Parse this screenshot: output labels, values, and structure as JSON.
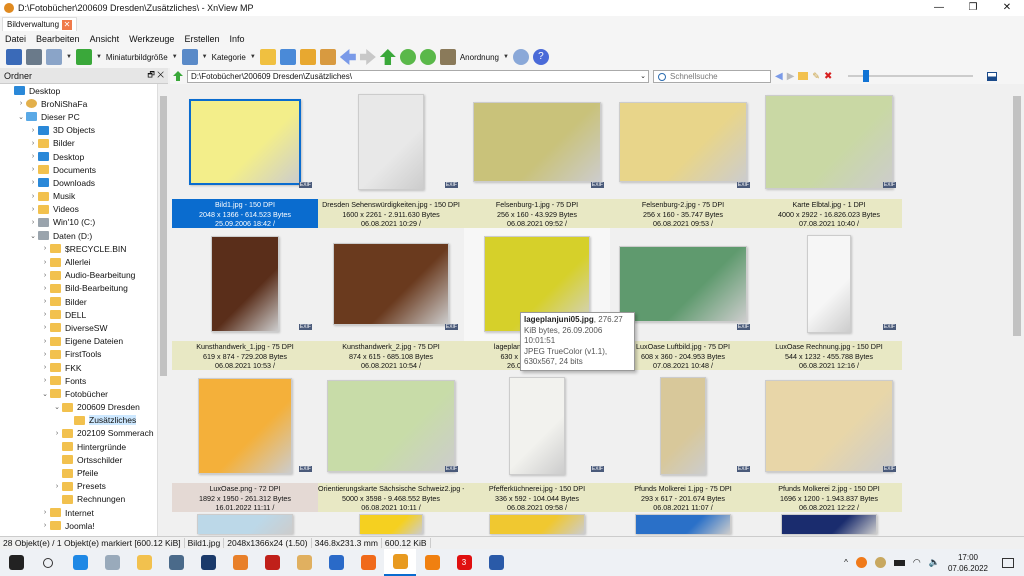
{
  "window": {
    "title": "D:\\Fotobücher\\200609 Dresden\\Zusätzliches\\ - XnView MP",
    "minimize": "—",
    "maximize": "❐",
    "close": "✕"
  },
  "tab": {
    "label": "Bildverwaltung",
    "close": "✕"
  },
  "menu": [
    "Datei",
    "Bearbeiten",
    "Ansicht",
    "Werkzeuge",
    "Erstellen",
    "Info"
  ],
  "toolbar": {
    "thumb_size": "Miniaturbildgröße",
    "category": "Kategorie",
    "arrange": "Anordnung"
  },
  "panel": {
    "title": "Ordner",
    "float": "🗗",
    "close": "✕"
  },
  "address": {
    "path": "D:\\Fotobücher\\200609 Dresden\\Zusätzliches\\",
    "search_placeholder": "Schnellsuche",
    "zoom_percent": 10
  },
  "tree": [
    {
      "label": "Desktop",
      "level": 0,
      "arrow": "",
      "icon": "blue"
    },
    {
      "label": "BroNiShaFa",
      "level": 1,
      "arrow": ">",
      "icon": "user"
    },
    {
      "label": "Dieser PC",
      "level": 1,
      "arrow": "v",
      "icon": "pc"
    },
    {
      "label": "3D Objects",
      "level": 2,
      "arrow": ">",
      "icon": "blue"
    },
    {
      "label": "Bilder",
      "level": 2,
      "arrow": ">",
      "icon": "folder"
    },
    {
      "label": "Desktop",
      "level": 2,
      "arrow": ">",
      "icon": "blue"
    },
    {
      "label": "Documents",
      "level": 2,
      "arrow": ">",
      "icon": "folder"
    },
    {
      "label": "Downloads",
      "level": 2,
      "arrow": ">",
      "icon": "blue"
    },
    {
      "label": "Musik",
      "level": 2,
      "arrow": ">",
      "icon": "folder"
    },
    {
      "label": "Videos",
      "level": 2,
      "arrow": ">",
      "icon": "folder"
    },
    {
      "label": "Win'10 (C:)",
      "level": 2,
      "arrow": ">",
      "icon": "drive"
    },
    {
      "label": "Daten (D:)",
      "level": 2,
      "arrow": "v",
      "icon": "drive"
    },
    {
      "label": "$RECYCLE.BIN",
      "level": 3,
      "arrow": ">",
      "icon": "folder"
    },
    {
      "label": "Allerlei",
      "level": 3,
      "arrow": ">",
      "icon": "folder"
    },
    {
      "label": "Audio-Bearbeitung",
      "level": 3,
      "arrow": ">",
      "icon": "folder"
    },
    {
      "label": "Bild-Bearbeitung",
      "level": 3,
      "arrow": ">",
      "icon": "folder"
    },
    {
      "label": "Bilder",
      "level": 3,
      "arrow": ">",
      "icon": "folder"
    },
    {
      "label": "DELL",
      "level": 3,
      "arrow": ">",
      "icon": "folder"
    },
    {
      "label": "DiverseSW",
      "level": 3,
      "arrow": ">",
      "icon": "folder"
    },
    {
      "label": "Eigene Dateien",
      "level": 3,
      "arrow": ">",
      "icon": "folder"
    },
    {
      "label": "FirstTools",
      "level": 3,
      "arrow": ">",
      "icon": "folder"
    },
    {
      "label": "FKK",
      "level": 3,
      "arrow": ">",
      "icon": "folder"
    },
    {
      "label": "Fonts",
      "level": 3,
      "arrow": ">",
      "icon": "folder"
    },
    {
      "label": "Fotobücher",
      "level": 3,
      "arrow": "v",
      "icon": "folder"
    },
    {
      "label": "200609 Dresden",
      "level": 4,
      "arrow": "v",
      "icon": "folder"
    },
    {
      "label": "Zusätzliches",
      "level": 5,
      "arrow": "",
      "icon": "folder",
      "selected": true
    },
    {
      "label": "202109 Sommerach",
      "level": 4,
      "arrow": ">",
      "icon": "folder"
    },
    {
      "label": "Hintergründe",
      "level": 4,
      "arrow": "",
      "icon": "folder"
    },
    {
      "label": "Ortsschilder",
      "level": 4,
      "arrow": "",
      "icon": "folder"
    },
    {
      "label": "Pfeile",
      "level": 4,
      "arrow": "",
      "icon": "folder"
    },
    {
      "label": "Presets",
      "level": 4,
      "arrow": ">",
      "icon": "folder"
    },
    {
      "label": "Rechnungen",
      "level": 4,
      "arrow": "",
      "icon": "folder"
    },
    {
      "label": "Internet",
      "level": 3,
      "arrow": ">",
      "icon": "folder"
    },
    {
      "label": "Joomla!",
      "level": 3,
      "arrow": ">",
      "icon": "folder"
    }
  ],
  "files": [
    {
      "name": "Bild1.jpg - 150 DPI",
      "dims": "2048 x 1366 - 614.523 Bytes",
      "date": "25.09.2006 18:42 /",
      "color": "#f3ee8a",
      "w": 112,
      "h": 86,
      "selected": true
    },
    {
      "name": "Dresden Sehenswürdigkeiten.jpg - 150 DPI",
      "dims": "1600 x 2261 - 2.911.630 Bytes",
      "date": "06.08.2021 10:29 /",
      "color": "#e8e8e8",
      "w": 66,
      "h": 96
    },
    {
      "name": "Felsenburg-1.jpg - 75 DPI",
      "dims": "256 x 160 - 43.929 Bytes",
      "date": "06.08.2021 09:52 /",
      "color": "#c9c27a",
      "w": 128,
      "h": 80
    },
    {
      "name": "Felsenburg-2.jpg - 75 DPI",
      "dims": "256 x 160 - 35.747 Bytes",
      "date": "06.08.2021 09:53 /",
      "color": "#e8d58a",
      "w": 128,
      "h": 80
    },
    {
      "name": "Karte Elbtal.jpg - 1 DPI",
      "dims": "4000 x 2922 - 16.826.023 Bytes",
      "date": "07.08.2021 10:40 /",
      "color": "#c9d8a4",
      "w": 128,
      "h": 94
    },
    {
      "name": "Kunsthandwerk_1.jpg - 75 DPI",
      "dims": "619 x 874 - 729.208 Bytes",
      "date": "06.08.2021 10:53 /",
      "color": "#5a2e1a",
      "w": 68,
      "h": 96
    },
    {
      "name": "Kunsthandwerk_2.jpg - 75 DPI",
      "dims": "874 x 615 - 685.108 Bytes",
      "date": "06.08.2021 10:54 /",
      "color": "#6a3a1e",
      "w": 116,
      "h": 82
    },
    {
      "name": "lageplanjuni05.jpg - 75 DPI",
      "dims": "630 x 567 - 276.27 KiB",
      "date": "26.09.2006 10:01 /",
      "color": "#d6d02a",
      "w": 106,
      "h": 96,
      "hover": true
    },
    {
      "name": "LuxOase Luftbild.jpg - 75 DPI",
      "dims": "608 x 360 - 204.953 Bytes",
      "date": "07.08.2021 10:48 /",
      "color": "#5f9a6e",
      "w": 128,
      "h": 76
    },
    {
      "name": "LuxOase Rechnung.jpg - 150 DPI",
      "dims": "544 x 1232 - 455.788 Bytes",
      "date": "06.08.2021 12:16 /",
      "color": "#f6f6f6",
      "w": 44,
      "h": 98
    },
    {
      "name": "LuxOase.png - 72 DPI",
      "dims": "1892 x 1950 - 261.312 Bytes",
      "date": "16.01.2022 11:11 /",
      "color": "#f4b03a",
      "w": 94,
      "h": 96,
      "pink": true
    },
    {
      "name": "Orientierungskarte Sächsische Schweiz2.jpg - ...",
      "dims": "5000 x 3598 - 9.468.552 Bytes",
      "date": "06.08.2021 10:11 /",
      "color": "#c8dca8",
      "w": 128,
      "h": 92
    },
    {
      "name": "Pfefferküchnerei.jpg - 150 DPI",
      "dims": "336 x 592 - 104.044 Bytes",
      "date": "06.08.2021 09:58 /",
      "color": "#f2f2ee",
      "w": 56,
      "h": 98
    },
    {
      "name": "Pfunds Molkerei 1.jpg - 75 DPI",
      "dims": "293 x 617 - 201.674 Bytes",
      "date": "06.08.2021 11:07 /",
      "color": "#d8c89a",
      "w": 46,
      "h": 98
    },
    {
      "name": "Pfunds Molkerei 2.jpg - 150 DPI",
      "dims": "1696 x 1200 - 1.943.837 Bytes",
      "date": "06.08.2021 12:22 /",
      "color": "#e8d6a8",
      "w": 128,
      "h": 92
    },
    {
      "name": "",
      "dims": "",
      "date": "",
      "color": "#bcd8e8",
      "w": 96,
      "h": 80
    },
    {
      "name": "",
      "dims": "",
      "date": "",
      "color": "#f5d020",
      "w": 64,
      "h": 80
    },
    {
      "name": "",
      "dims": "",
      "date": "",
      "color": "#f0c830",
      "w": 96,
      "h": 80
    },
    {
      "name": "",
      "dims": "",
      "date": "",
      "color": "#2a70c8",
      "w": 96,
      "h": 80
    },
    {
      "name": "",
      "dims": "",
      "date": "",
      "color": "#1a2c6e",
      "w": 96,
      "h": 80
    }
  ],
  "exif_badge": "EXIF",
  "tooltip": {
    "filename": "lageplanjuni05.jpg",
    "line1": ", 276.27",
    "line2": "KiB bytes, 26.09.2006 10:01:51",
    "line3": "JPEG TrueColor (v1.1),",
    "line4": "630x567, 24 bits"
  },
  "status": [
    "28 Objekt(e) / 1 Objekt(e) markiert [600.12 KiB]",
    "Bild1.jpg",
    "2048x1366x24 (1.50)",
    "346.8x231.3 mm",
    "600.12 KiB"
  ],
  "taskbar": {
    "apps": [
      {
        "name": "start",
        "color": "#222"
      },
      {
        "name": "search",
        "color": "transparent"
      },
      {
        "name": "app-blue",
        "color": "#1e88e5"
      },
      {
        "name": "app-xp",
        "color": "#9ab"
      },
      {
        "name": "explorer",
        "color": "#f2c14e"
      },
      {
        "name": "calculator",
        "color": "#4a6a8a"
      },
      {
        "name": "lock",
        "color": "#1a3a6a"
      },
      {
        "name": "xampp",
        "color": "#e8802a"
      },
      {
        "name": "filezilla",
        "color": "#c0201a"
      },
      {
        "name": "mail",
        "color": "#e0b060"
      },
      {
        "name": "thunderbird",
        "color": "#2a6ac8"
      },
      {
        "name": "firefox",
        "color": "#f06a1a"
      },
      {
        "name": "xnview",
        "color": "#e89a20",
        "active": true
      },
      {
        "name": "vlc",
        "color": "#f08010"
      },
      {
        "name": "app-red",
        "color": "#e01010"
      },
      {
        "name": "save-app",
        "color": "#2a5aa8"
      }
    ],
    "badge": "3",
    "time": "17:00",
    "date": "07.06.2022"
  }
}
